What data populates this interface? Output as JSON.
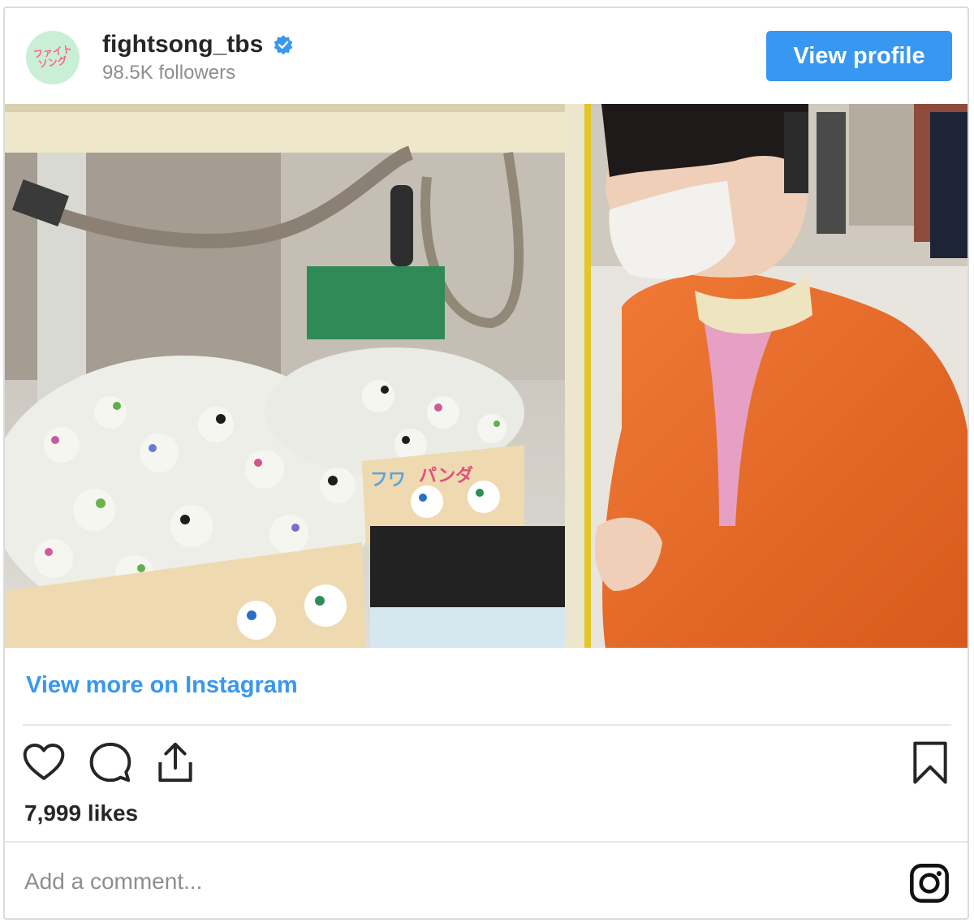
{
  "header": {
    "avatar_text_line1": "ファイト",
    "avatar_text_line2": "ソング",
    "username": "fightsong_tbs",
    "followers": "98.5K followers",
    "view_profile_label": "View profile"
  },
  "post": {
    "image_icon": "photo-image",
    "view_more_label": "View more on Instagram",
    "likes": "7,999 likes",
    "comment_placeholder": "Add a comment..."
  },
  "icons": {
    "like": "heart-icon",
    "comment": "comment-icon",
    "share": "share-icon",
    "save": "bookmark-icon",
    "instagram": "instagram-icon",
    "verified": "verified-badge-icon"
  },
  "colors": {
    "accent": "#3897f0",
    "text": "#262626",
    "muted": "#8e8e8e",
    "border": "#dbdbdb"
  }
}
